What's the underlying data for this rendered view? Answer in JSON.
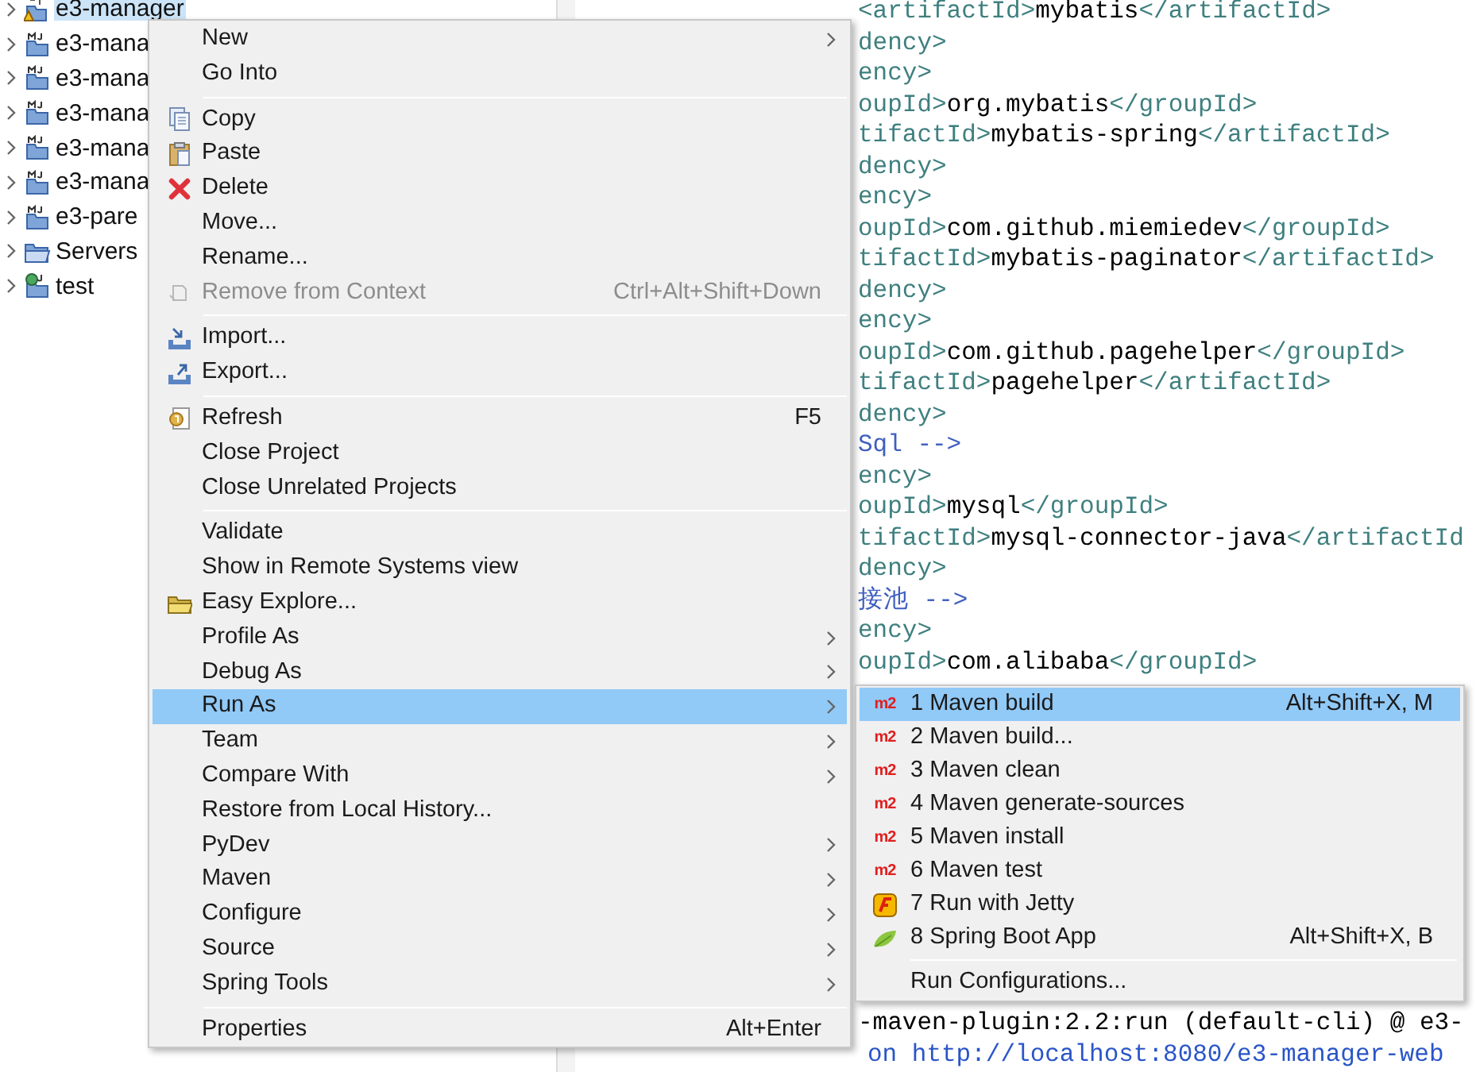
{
  "tree": [
    {
      "label": "e3-manager",
      "kind": "warning-project",
      "selected": true
    },
    {
      "label": "e3-mana",
      "kind": "maven-project",
      "selected": false
    },
    {
      "label": "e3-mana",
      "kind": "maven-project",
      "selected": false
    },
    {
      "label": "e3-mana",
      "kind": "maven-project",
      "selected": false
    },
    {
      "label": "e3-mana",
      "kind": "maven-project",
      "selected": false
    },
    {
      "label": "e3-mana",
      "kind": "maven-project",
      "selected": false
    },
    {
      "label": "e3-pare",
      "kind": "maven-project",
      "selected": false
    },
    {
      "label": "Servers",
      "kind": "folder",
      "selected": false
    },
    {
      "label": "test",
      "kind": "web-project",
      "selected": false
    }
  ],
  "editor": {
    "lines": [
      [
        {
          "kind": "tag",
          "text": "<artifactId>"
        },
        {
          "kind": "text",
          "text": "mybatis"
        },
        {
          "kind": "tag",
          "text": "</artifactId>"
        }
      ],
      [
        {
          "kind": "tag",
          "text": "dency>"
        }
      ],
      [
        {
          "kind": "tag",
          "text": "ency>"
        }
      ],
      [
        {
          "kind": "tag",
          "text": "oupId>"
        },
        {
          "kind": "text",
          "text": "org.mybatis"
        },
        {
          "kind": "tag",
          "text": "</groupId>"
        }
      ],
      [
        {
          "kind": "tag",
          "text": "tifactId>"
        },
        {
          "kind": "text",
          "text": "mybatis-spring"
        },
        {
          "kind": "tag",
          "text": "</artifactId>"
        }
      ],
      [
        {
          "kind": "tag",
          "text": "dency>"
        }
      ],
      [
        {
          "kind": "tag",
          "text": "ency>"
        }
      ],
      [
        {
          "kind": "tag",
          "text": "oupId>"
        },
        {
          "kind": "text",
          "text": "com.github.miemiedev"
        },
        {
          "kind": "tag",
          "text": "</groupId>"
        }
      ],
      [
        {
          "kind": "tag",
          "text": "tifactId>"
        },
        {
          "kind": "text",
          "text": "mybatis-paginator"
        },
        {
          "kind": "tag",
          "text": "</artifactId>"
        }
      ],
      [
        {
          "kind": "tag",
          "text": "dency>"
        }
      ],
      [
        {
          "kind": "tag",
          "text": "ency>"
        }
      ],
      [
        {
          "kind": "tag",
          "text": "oupId>"
        },
        {
          "kind": "text",
          "text": "com.github.pagehelper"
        },
        {
          "kind": "tag",
          "text": "</groupId>"
        }
      ],
      [
        {
          "kind": "tag",
          "text": "tifactId>"
        },
        {
          "kind": "text",
          "text": "pagehelper"
        },
        {
          "kind": "tag",
          "text": "</artifactId>"
        }
      ],
      [
        {
          "kind": "tag",
          "text": "dency>"
        }
      ],
      [
        {
          "kind": "comment",
          "text": "Sql -->"
        }
      ],
      [
        {
          "kind": "tag",
          "text": "ency>"
        }
      ],
      [
        {
          "kind": "tag",
          "text": "oupId>"
        },
        {
          "kind": "text",
          "text": "mysql"
        },
        {
          "kind": "tag",
          "text": "</groupId>"
        }
      ],
      [
        {
          "kind": "tag",
          "text": "tifactId>"
        },
        {
          "kind": "text",
          "text": "mysql-connector-java"
        },
        {
          "kind": "tag",
          "text": "</artifactId"
        }
      ],
      [
        {
          "kind": "tag",
          "text": "dency>"
        }
      ],
      [
        {
          "kind": "comment",
          "text": "接池 -->"
        }
      ],
      [
        {
          "kind": "tag",
          "text": "ency>"
        }
      ],
      [
        {
          "kind": "tag",
          "text": "oupId>"
        },
        {
          "kind": "text",
          "text": "com.alibaba"
        },
        {
          "kind": "tag",
          "text": "</groupId>"
        }
      ]
    ]
  },
  "console": {
    "lines": [
      {
        "kind": "output",
        "text": "-maven-plugin:2.2:run (default-cli) @ e3-"
      },
      {
        "kind": "link",
        "text": "on http://localhost:8080/e3-manager-web"
      }
    ]
  },
  "menu": {
    "items": [
      {
        "kind": "plain",
        "label": "New",
        "submenu": true,
        "disabled": false,
        "selected": false
      },
      {
        "kind": "plain",
        "label": "Go Into",
        "submenu": false,
        "disabled": false,
        "selected": false
      },
      {
        "kind": "separator"
      },
      {
        "kind": "copy",
        "label": "Copy",
        "submenu": false,
        "disabled": false,
        "selected": false
      },
      {
        "kind": "paste",
        "label": "Paste",
        "submenu": false,
        "disabled": false,
        "selected": false
      },
      {
        "kind": "delete",
        "label": "Delete",
        "submenu": false,
        "disabled": false,
        "selected": false
      },
      {
        "kind": "plain",
        "label": "Move...",
        "submenu": false,
        "disabled": false,
        "selected": false
      },
      {
        "kind": "plain",
        "label": "Rename...",
        "submenu": false,
        "disabled": false,
        "selected": false
      },
      {
        "kind": "remove",
        "label": "Remove from Context",
        "shortcut": "Ctrl+Alt+Shift+Down",
        "submenu": false,
        "disabled": true,
        "selected": false
      },
      {
        "kind": "separator"
      },
      {
        "kind": "import",
        "label": "Import...",
        "submenu": false,
        "disabled": false,
        "selected": false
      },
      {
        "kind": "export",
        "label": "Export...",
        "submenu": false,
        "disabled": false,
        "selected": false
      },
      {
        "kind": "separator"
      },
      {
        "kind": "refresh",
        "label": "Refresh",
        "shortcut": "F5",
        "submenu": false,
        "disabled": false,
        "selected": false
      },
      {
        "kind": "plain",
        "label": "Close Project",
        "submenu": false,
        "disabled": false,
        "selected": false
      },
      {
        "kind": "plain",
        "label": "Close Unrelated Projects",
        "submenu": false,
        "disabled": false,
        "selected": false
      },
      {
        "kind": "separator"
      },
      {
        "kind": "plain",
        "label": "Validate",
        "submenu": false,
        "disabled": false,
        "selected": false
      },
      {
        "kind": "plain",
        "label": "Show in Remote Systems view",
        "submenu": false,
        "disabled": false,
        "selected": false
      },
      {
        "kind": "folder",
        "label": "Easy Explore...",
        "submenu": false,
        "disabled": false,
        "selected": false
      },
      {
        "kind": "plain",
        "label": "Profile As",
        "submenu": true,
        "disabled": false,
        "selected": false
      },
      {
        "kind": "plain",
        "label": "Debug As",
        "submenu": true,
        "disabled": false,
        "selected": false
      },
      {
        "kind": "plain",
        "label": "Run As",
        "submenu": true,
        "disabled": false,
        "selected": true
      },
      {
        "kind": "plain",
        "label": "Team",
        "submenu": true,
        "disabled": false,
        "selected": false
      },
      {
        "kind": "plain",
        "label": "Compare With",
        "submenu": true,
        "disabled": false,
        "selected": false
      },
      {
        "kind": "plain",
        "label": "Restore from Local History...",
        "submenu": false,
        "disabled": false,
        "selected": false
      },
      {
        "kind": "plain",
        "label": "PyDev",
        "submenu": true,
        "disabled": false,
        "selected": false
      },
      {
        "kind": "plain",
        "label": "Maven",
        "submenu": true,
        "disabled": false,
        "selected": false
      },
      {
        "kind": "plain",
        "label": "Configure",
        "submenu": true,
        "disabled": false,
        "selected": false
      },
      {
        "kind": "plain",
        "label": "Source",
        "submenu": true,
        "disabled": false,
        "selected": false
      },
      {
        "kind": "plain",
        "label": "Spring Tools",
        "submenu": true,
        "disabled": false,
        "selected": false
      },
      {
        "kind": "separator"
      },
      {
        "kind": "plain",
        "label": "Properties",
        "shortcut": "Alt+Enter",
        "submenu": false,
        "disabled": false,
        "selected": false
      }
    ]
  },
  "submenu": {
    "items": [
      {
        "kind": "maven",
        "label": "1 Maven build",
        "icon_text": "m2",
        "shortcut": "Alt+Shift+X, M",
        "selected": true
      },
      {
        "kind": "maven",
        "label": "2 Maven build...",
        "icon_text": "m2",
        "selected": false
      },
      {
        "kind": "maven",
        "label": "3 Maven clean",
        "icon_text": "m2",
        "selected": false
      },
      {
        "kind": "maven",
        "label": "4 Maven generate-sources",
        "icon_text": "m2",
        "selected": false
      },
      {
        "kind": "maven",
        "label": "5 Maven install",
        "icon_text": "m2",
        "selected": false
      },
      {
        "kind": "maven",
        "label": "6 Maven test",
        "icon_text": "m2",
        "selected": false
      },
      {
        "kind": "jetty",
        "label": "7 Run with Jetty",
        "selected": false
      },
      {
        "kind": "leaf",
        "label": "8 Spring Boot App",
        "shortcut": "Alt+Shift+X, B",
        "selected": false
      },
      {
        "kind": "separator"
      },
      {
        "kind": "plain",
        "label": "Run Configurations...",
        "selected": false
      }
    ]
  }
}
